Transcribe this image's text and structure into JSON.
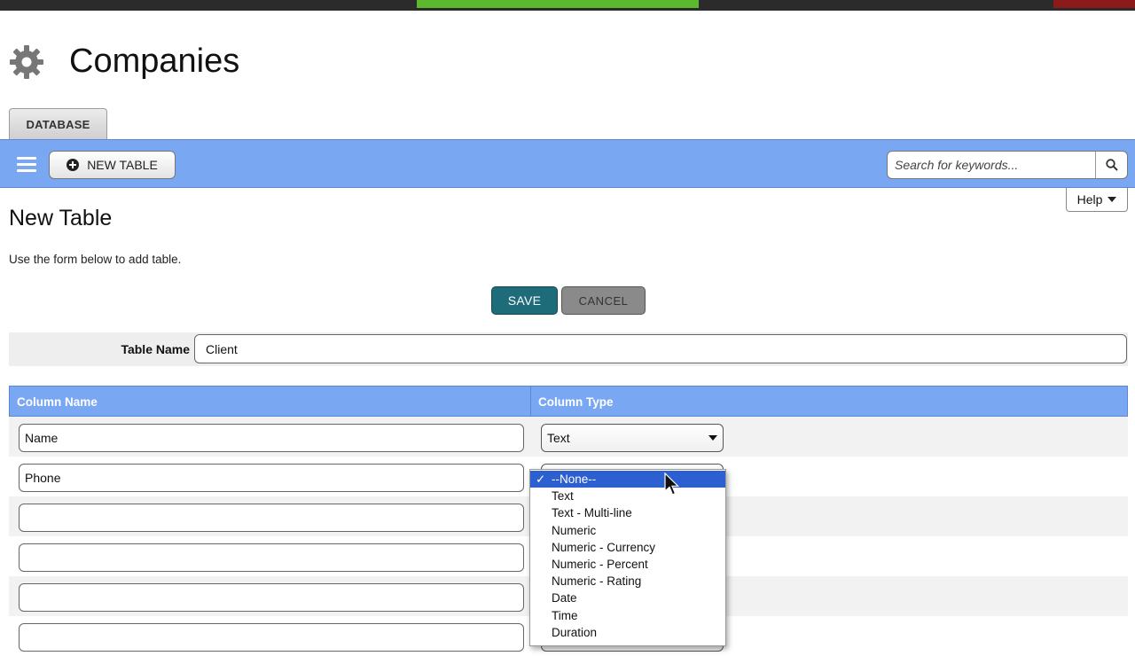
{
  "app": {
    "title": "Companies",
    "tab_label": "DATABASE"
  },
  "navbar": {
    "new_table_label": "NEW TABLE",
    "search_placeholder": "Search for keywords..."
  },
  "help_label": "Help",
  "page": {
    "title": "New Table",
    "description": "Use the form below to add table."
  },
  "buttons": {
    "save": "SAVE",
    "cancel": "CANCEL"
  },
  "table_name": {
    "label": "Table Name",
    "value": "Client"
  },
  "columns_header": {
    "name": "Column Name",
    "type": "Column Type"
  },
  "rows": [
    {
      "name": "Name",
      "type": "Text"
    },
    {
      "name": "Phone",
      "type": ""
    },
    {
      "name": "",
      "type": ""
    },
    {
      "name": "",
      "type": ""
    },
    {
      "name": "",
      "type": ""
    },
    {
      "name": "",
      "type": ""
    }
  ],
  "dropdown": {
    "selected_index": 0,
    "options": [
      "--None--",
      "Text",
      "Text - Multi-line",
      "Numeric",
      "Numeric - Currency",
      "Numeric - Percent",
      "Numeric - Rating",
      "Date",
      "Time",
      "Duration"
    ]
  },
  "colors": {
    "navbar": "#7aa7f2",
    "save": "#1e6b7a",
    "selected_option": "#2c5fd0"
  },
  "icons": {
    "app": "gear-icon",
    "menu": "hamburger-icon",
    "new": "plus-circle-icon",
    "search": "search-icon",
    "dropdown": "chevron-down-icon",
    "check": "checkmark-icon"
  }
}
